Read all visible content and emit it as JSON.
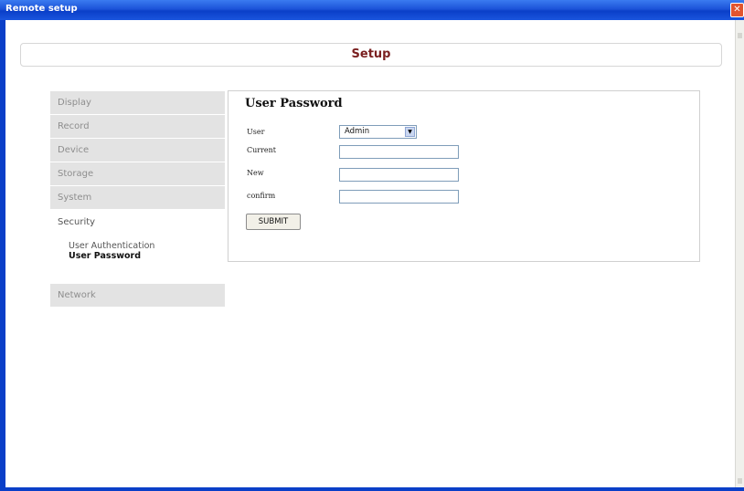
{
  "window": {
    "title": "Remote setup",
    "close_glyph": "✕"
  },
  "header": {
    "title": "Setup"
  },
  "sidebar": {
    "items": [
      {
        "label": "Display"
      },
      {
        "label": "Record"
      },
      {
        "label": "Device"
      },
      {
        "label": "Storage"
      },
      {
        "label": "System"
      },
      {
        "label": "Security",
        "active": true,
        "subitems": [
          {
            "label": "User Authentication"
          },
          {
            "label": "User Password",
            "active": true
          }
        ]
      },
      {
        "label": "Network"
      }
    ]
  },
  "panel": {
    "title": "User Password",
    "fields": {
      "user": {
        "label": "User",
        "value": "Admin",
        "arrow": "▼"
      },
      "current": {
        "label": "Current",
        "value": ""
      },
      "new": {
        "label": "New",
        "value": ""
      },
      "confirm": {
        "label": "confirm",
        "value": ""
      }
    },
    "submit_label": "SUBMIT"
  },
  "colors": {
    "titlebar": "#0a3fc8",
    "header_text": "#7a1f1f",
    "sidebar_bg": "#e3e3e3"
  }
}
